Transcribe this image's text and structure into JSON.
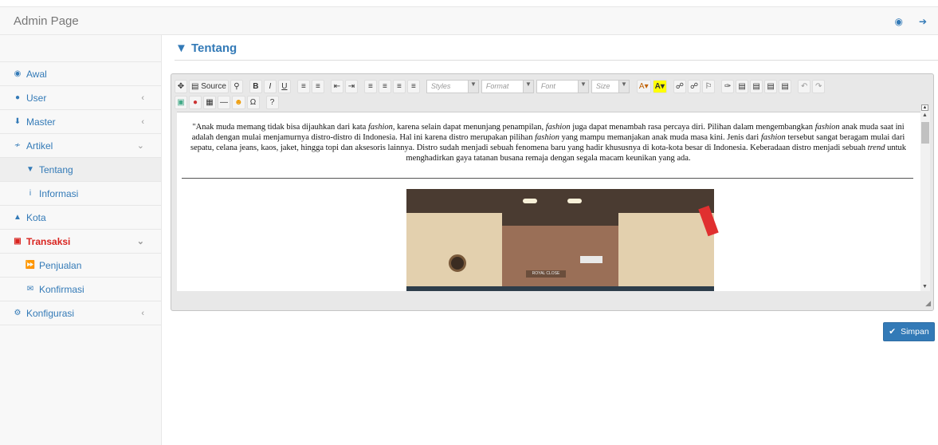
{
  "header": {
    "title": "Admin Page",
    "icons": [
      "eye-icon",
      "sign-out-icon"
    ]
  },
  "sidebar": {
    "items": [
      {
        "label": "Awal",
        "icon": "dashboard-icon"
      },
      {
        "label": "User",
        "icon": "users-icon",
        "arrow": "‹"
      },
      {
        "label": "Master",
        "icon": "download-icon",
        "arrow": "‹"
      },
      {
        "label": "Artikel",
        "icon": "rss-icon",
        "arrow": "⌄"
      },
      {
        "label": "Tentang",
        "icon": "filter-icon"
      },
      {
        "label": "Informasi",
        "icon": "info-icon"
      },
      {
        "label": "Kota",
        "icon": "pin-icon"
      },
      {
        "label": "Transaksi",
        "icon": "money-icon",
        "arrow": "⌄"
      },
      {
        "label": "Penjualan",
        "icon": "fast-forward-icon"
      },
      {
        "label": "Konfirmasi",
        "icon": "envelope-icon"
      },
      {
        "label": "Konfigurasi",
        "icon": "cogs-icon",
        "arrow": "‹"
      }
    ]
  },
  "page": {
    "title": "Tentang"
  },
  "editor": {
    "toolbar": {
      "source_label": "Source",
      "styles": "Styles",
      "format": "Format",
      "font": "Font",
      "size": "Size"
    },
    "content": {
      "p1": "\"Anak muda memang tidak bisa dijauhkan dari kata ",
      "fashion": "fashion",
      "p2": ", karena selain dapat menunjang penampilan, ",
      "p3": " juga dapat menambah rasa percaya diri. Pilihan dalam mengembangkan ",
      "p4": " anak muda saat ini adalah dengan mulai menjamurnya distro-distro di Indonesia. Hal ini karena distro merupakan pilihan ",
      "p5": " yang mampu memanjakan anak muda masa kini. Jenis dari ",
      "p6": " tersebut sangat beragam mulai dari sepatu, celana jeans, kaos, jaket, hingga topi dan aksesoris lainnya. Distro sudah menjadi sebuah fenomena baru yang hadir khususnya di kota-kota besar di Indonesia. Keberadaan distro menjadi sebuah ",
      "trend": "trend",
      "p7": " untuk menghadirkan gaya tatanan busana remaja dengan segala macam keunikan yang ada.",
      "sign_text": "ROYAL CLOSE"
    }
  },
  "buttons": {
    "save": "Simpan"
  }
}
